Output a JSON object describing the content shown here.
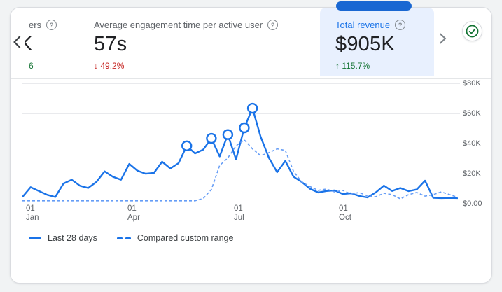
{
  "colors": {
    "accent": "#1a73e8",
    "compare_line": "#669df6",
    "selected_card_bg": "#e8f0fe",
    "tab_indicator": "#1967d2",
    "negative": "#c5221f",
    "positive": "#137333"
  },
  "metric_cards": [
    {
      "title_fragment": "ers",
      "help_icon": "?",
      "value_fragment": "K",
      "change_fragment": "6"
    },
    {
      "title": "Average engagement time per active user",
      "help_icon": "?",
      "value": "57s",
      "change_arrow": "↓",
      "change": "49.2%"
    },
    {
      "title": "Total revenue",
      "help_icon": "?",
      "value": "$905K",
      "change_arrow": "↑",
      "change": "115.7%",
      "selected": true
    }
  ],
  "chart_data": {
    "type": "line",
    "title": "",
    "xlabel": "",
    "ylabel": "",
    "values_unit": "USD thousands",
    "ylim": [
      0,
      80
    ],
    "grid": "horizontal",
    "legend_position": "bottom-left",
    "y_ticks": [
      "$80K",
      "$60K",
      "$40K",
      "$20K",
      "$0.00"
    ],
    "x_ticks": [
      [
        "01",
        "Jan"
      ],
      [
        "01",
        "Apr"
      ],
      [
        "01",
        "Jul"
      ],
      [
        "01",
        "Oct"
      ]
    ],
    "x_description": "weekly points from 01 Jan to late Dec",
    "series": [
      {
        "name": "Last 28 days",
        "style": "solid",
        "color": "#1a73e8",
        "values": [
          4,
          10.5,
          8,
          5.5,
          4,
          13,
          15.5,
          11.5,
          10,
          14,
          21,
          17.5,
          15.5,
          26,
          21.5,
          19.5,
          20,
          27.5,
          23,
          26.5,
          38,
          33,
          35.5,
          43,
          31,
          45.5,
          29,
          50,
          63,
          44,
          30,
          20.5,
          28,
          17.5,
          14,
          9.5,
          7,
          8,
          8.4,
          6,
          6.5,
          4.7,
          3.7,
          7,
          11.6,
          8,
          10,
          7.9,
          9,
          14.9,
          3.5,
          3.3,
          3.4,
          3.3
        ]
      },
      {
        "name": "Compared custom range",
        "style": "dashed",
        "color": "#669df6",
        "values": [
          1.5,
          1.5,
          1.5,
          1.5,
          1.5,
          1.5,
          1.5,
          1.5,
          1.5,
          1.5,
          1.5,
          1.5,
          1.5,
          1.5,
          1.5,
          1.5,
          1.5,
          1.5,
          1.5,
          1.5,
          1.5,
          1.5,
          3,
          9,
          25,
          30,
          38,
          42,
          36,
          31.5,
          33.5,
          36,
          35,
          21,
          14,
          11,
          8.4,
          9.3,
          7.4,
          8.4,
          6,
          7,
          4.7,
          4.2,
          6.5,
          5.6,
          2.8,
          5.6,
          7,
          4.6,
          5.6,
          7.4,
          5.6,
          3.7
        ]
      }
    ],
    "marker_indices": [
      20,
      23,
      25,
      27,
      28
    ]
  }
}
